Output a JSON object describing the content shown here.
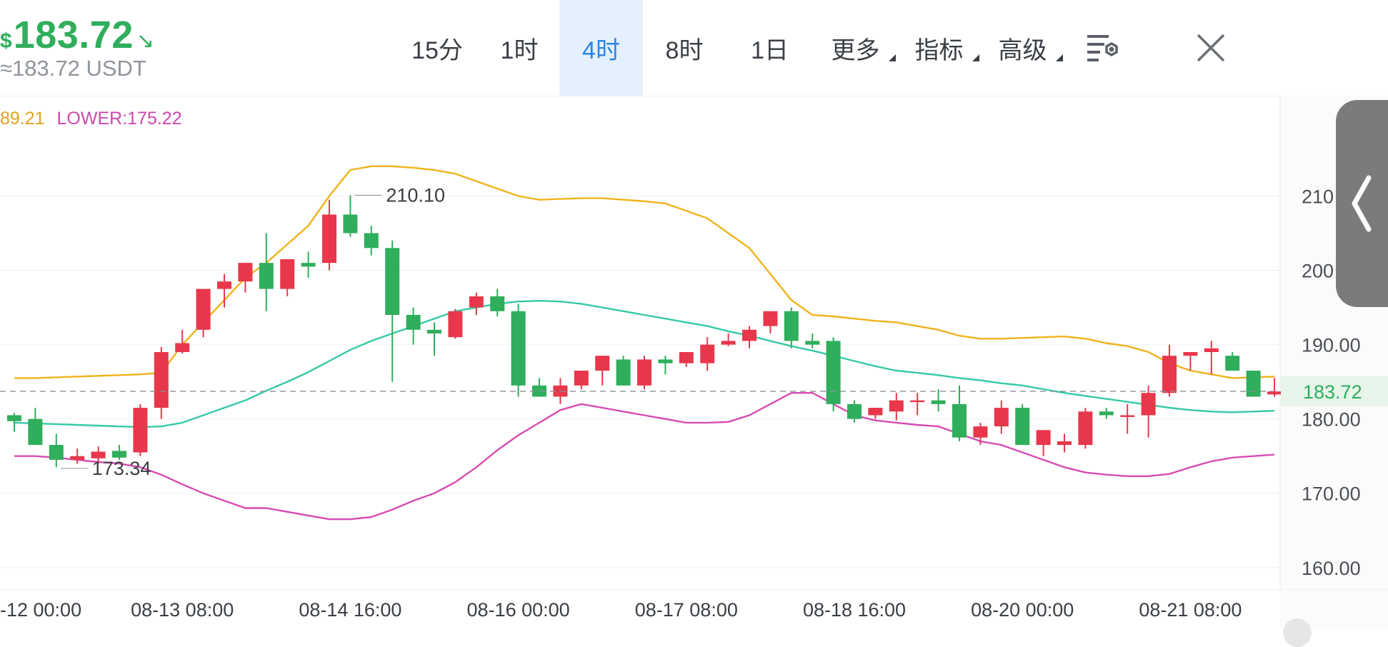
{
  "header": {
    "currency_symbol": "$",
    "price": "183.72",
    "approx": "≈183.72 USDT",
    "colors": {
      "price": "#2fae5c",
      "active_tab": "#2e86e0",
      "active_tab_bg": "#e4f0fc"
    }
  },
  "tabs": [
    {
      "label": "15分",
      "active": false,
      "dropdown": false
    },
    {
      "label": "1时",
      "active": false,
      "dropdown": false
    },
    {
      "label": "4时",
      "active": true,
      "dropdown": false
    },
    {
      "label": "8时",
      "active": false,
      "dropdown": false
    },
    {
      "label": "1日",
      "active": false,
      "dropdown": false
    },
    {
      "label": "更多",
      "active": false,
      "dropdown": true
    },
    {
      "label": "指标",
      "active": false,
      "dropdown": true
    },
    {
      "label": "高级",
      "active": false,
      "dropdown": true
    }
  ],
  "icons": {
    "settings": "chart-settings-icon",
    "close": "close-icon",
    "side": "chevron-left-icon",
    "price_trend": "arrow-down-right-icon"
  },
  "indicator": {
    "upper_partial": "89.21",
    "lower_label": "LOWER:175.22"
  },
  "chart_data": {
    "type": "candlestick",
    "title": "",
    "interval": "4时",
    "ylim": [
      157,
      221
    ],
    "y_ticks": [
      210,
      200,
      190,
      180,
      170,
      160
    ],
    "y_tick_labels": [
      "210",
      "200",
      "190.00",
      "180.00",
      "170.00",
      "160.00"
    ],
    "current_price": 183.72,
    "current_price_label": "183.72",
    "x_tick_labels": [
      "-12 00:00",
      "08-13 08:00",
      "08-14 16:00",
      "08-16 00:00",
      "08-17 08:00",
      "08-18 16:00",
      "08-20 00:00",
      "08-21 08:00"
    ],
    "x_tick_index": [
      0,
      8,
      16,
      24,
      32,
      40,
      48,
      56
    ],
    "annotations": [
      {
        "text": "210.10",
        "index": 16,
        "value": 210.1
      },
      {
        "text": "173.34",
        "index": 2,
        "value": 173.34
      }
    ],
    "colors": {
      "up": "#e8374b",
      "down": "#2fae5c",
      "upper": "#efb31a",
      "middle": "#36c9a6",
      "lower": "#d74bb2",
      "grid": "#eef0f2"
    },
    "candles": [
      [
        180.5,
        180.8,
        178.3,
        179.7
      ],
      [
        180.0,
        181.5,
        176.5,
        176.5
      ],
      [
        176.5,
        178.0,
        173.5,
        174.5
      ],
      [
        174.5,
        176.0,
        174.0,
        175.0
      ],
      [
        174.7,
        176.3,
        174.0,
        175.6
      ],
      [
        175.7,
        176.5,
        174.5,
        174.8
      ],
      [
        175.5,
        182.0,
        175.0,
        181.5
      ],
      [
        181.5,
        189.7,
        180.0,
        189.0
      ],
      [
        189.0,
        192.0,
        188.8,
        190.2
      ],
      [
        192.0,
        195.0,
        191.0,
        197.5
      ],
      [
        197.5,
        199.5,
        195.0,
        198.5
      ],
      [
        198.5,
        201.0,
        197.0,
        201.0
      ],
      [
        201.0,
        205.0,
        194.5,
        197.5
      ],
      [
        197.5,
        201.5,
        196.5,
        201.5
      ],
      [
        201.0,
        202.5,
        199.0,
        200.5
      ],
      [
        201.0,
        209.5,
        200.0,
        207.5
      ],
      [
        207.5,
        210.1,
        204.5,
        205.0
      ],
      [
        205.0,
        206.0,
        202.0,
        203.0
      ],
      [
        203.0,
        204.0,
        185.0,
        194.0
      ],
      [
        194.0,
        195.0,
        190.0,
        192.0
      ],
      [
        192.0,
        193.0,
        188.5,
        191.5
      ],
      [
        191.0,
        194.8,
        190.8,
        194.5
      ],
      [
        195.0,
        197.0,
        194.0,
        196.5
      ],
      [
        196.5,
        197.5,
        193.8,
        194.5
      ],
      [
        194.5,
        195.5,
        183.0,
        184.5
      ],
      [
        184.5,
        185.5,
        183.0,
        183.0
      ],
      [
        183.0,
        185.5,
        182.0,
        184.5
      ],
      [
        184.5,
        186.5,
        184.0,
        186.5
      ],
      [
        186.5,
        188.5,
        184.5,
        188.5
      ],
      [
        188.0,
        188.5,
        184.5,
        184.5
      ],
      [
        184.5,
        188.5,
        184.0,
        188.0
      ],
      [
        188.0,
        188.5,
        186.0,
        187.5
      ],
      [
        187.5,
        189.0,
        187.0,
        189.0
      ],
      [
        187.5,
        191.0,
        186.5,
        190.0
      ],
      [
        190.0,
        191.5,
        189.8,
        190.5
      ],
      [
        190.5,
        192.5,
        189.5,
        192.0
      ],
      [
        192.5,
        194.5,
        191.5,
        194.5
      ],
      [
        194.5,
        195.0,
        189.5,
        190.5
      ],
      [
        190.5,
        191.5,
        189.5,
        190.0
      ],
      [
        190.5,
        191.0,
        181.0,
        182.0
      ],
      [
        182.0,
        182.5,
        179.5,
        180.0
      ],
      [
        180.5,
        181.5,
        180.0,
        181.5
      ],
      [
        181.0,
        183.5,
        179.8,
        182.5
      ],
      [
        182.5,
        183.5,
        180.5,
        182.5
      ],
      [
        182.5,
        184.0,
        181.0,
        182.0
      ],
      [
        182.0,
        184.5,
        177.0,
        177.5
      ],
      [
        177.5,
        179.5,
        176.5,
        179.0
      ],
      [
        179.0,
        182.5,
        178.0,
        181.5
      ],
      [
        181.5,
        182.0,
        177.5,
        176.5
      ],
      [
        176.5,
        178.0,
        175.0,
        178.5
      ],
      [
        176.5,
        178.0,
        175.5,
        177.0
      ],
      [
        176.5,
        181.5,
        176.0,
        181.0
      ],
      [
        181.0,
        181.5,
        180.0,
        180.5
      ],
      [
        180.5,
        182.0,
        178.0,
        180.5
      ],
      [
        180.5,
        184.5,
        177.5,
        183.5
      ],
      [
        183.5,
        190.0,
        183.0,
        188.5
      ],
      [
        188.5,
        189.0,
        186.5,
        189.0
      ],
      [
        189.0,
        190.5,
        186.0,
        189.5
      ],
      [
        188.5,
        189.0,
        186.5,
        186.5
      ],
      [
        186.5,
        186.5,
        183.0,
        183.0
      ],
      [
        183.3,
        185.5,
        183.0,
        183.7
      ]
    ],
    "bollinger": {
      "upper": [
        185.5,
        185.5,
        185.6,
        185.7,
        185.8,
        185.9,
        186.0,
        186.2,
        190.0,
        193.0,
        196.0,
        199.0,
        201.0,
        203.5,
        206.0,
        210.0,
        213.5,
        214.0,
        214.0,
        213.8,
        213.5,
        213.0,
        212.0,
        211.0,
        210.0,
        209.5,
        209.6,
        209.7,
        209.7,
        209.5,
        209.3,
        209.0,
        208.0,
        207.0,
        205.0,
        203.0,
        199.5,
        196.0,
        194.0,
        193.8,
        193.5,
        193.2,
        193.0,
        192.5,
        192.0,
        191.2,
        190.8,
        190.8,
        190.9,
        191.0,
        191.1,
        190.8,
        190.2,
        189.8,
        189.0,
        187.5,
        186.5,
        186.0,
        185.5,
        185.6,
        185.7
      ],
      "middle": [
        179.5,
        179.4,
        179.3,
        179.2,
        179.1,
        179.0,
        178.9,
        179.0,
        179.5,
        180.5,
        181.5,
        182.5,
        183.8,
        185.0,
        186.3,
        187.8,
        189.3,
        190.5,
        191.5,
        192.5,
        193.5,
        194.5,
        195.0,
        195.5,
        195.8,
        195.9,
        195.8,
        195.5,
        195.0,
        194.5,
        194.0,
        193.5,
        193.0,
        192.5,
        191.8,
        191.2,
        190.5,
        189.8,
        189.2,
        188.5,
        187.8,
        187.1,
        186.5,
        186.2,
        185.9,
        185.5,
        185.2,
        184.8,
        184.5,
        184.0,
        183.5,
        183.1,
        182.7,
        182.3,
        181.9,
        181.5,
        181.2,
        181.0,
        180.9,
        181.0,
        181.1
      ],
      "lower": [
        175.0,
        175.0,
        174.8,
        174.5,
        174.2,
        174.0,
        173.5,
        172.5,
        171.2,
        170.0,
        169.0,
        168.0,
        168.0,
        167.5,
        167.0,
        166.5,
        166.5,
        166.8,
        167.8,
        169.0,
        170.0,
        171.5,
        173.5,
        175.8,
        177.8,
        179.5,
        181.2,
        182.0,
        181.5,
        181.0,
        180.5,
        180.0,
        179.5,
        179.5,
        179.6,
        180.5,
        182.0,
        183.5,
        183.5,
        182.0,
        180.5,
        179.8,
        179.5,
        179.2,
        179.0,
        178.0,
        177.0,
        176.5,
        175.5,
        174.5,
        173.5,
        172.8,
        172.5,
        172.3,
        172.3,
        172.6,
        173.5,
        174.3,
        174.8,
        175.0,
        175.2
      ]
    }
  }
}
